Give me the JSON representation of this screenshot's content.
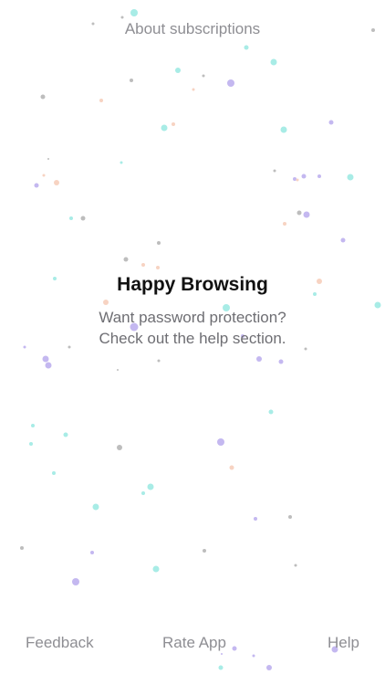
{
  "header": {
    "about_link": "About subscriptions"
  },
  "empty_state": {
    "title": "Happy Browsing",
    "line1": "Want password protection?",
    "line2": "Check out the help section."
  },
  "bottom_bar": {
    "feedback_label": "Feedback",
    "rate_label": "Rate App",
    "help_label": "Help"
  },
  "colors": {
    "text_primary": "#111111",
    "text_secondary": "#8e8e93",
    "dot_cyan": "#a8ece6",
    "dot_purple": "#c4b8f0",
    "dot_gray": "#bdbdbd",
    "dot_peach": "#f7d3c2"
  }
}
